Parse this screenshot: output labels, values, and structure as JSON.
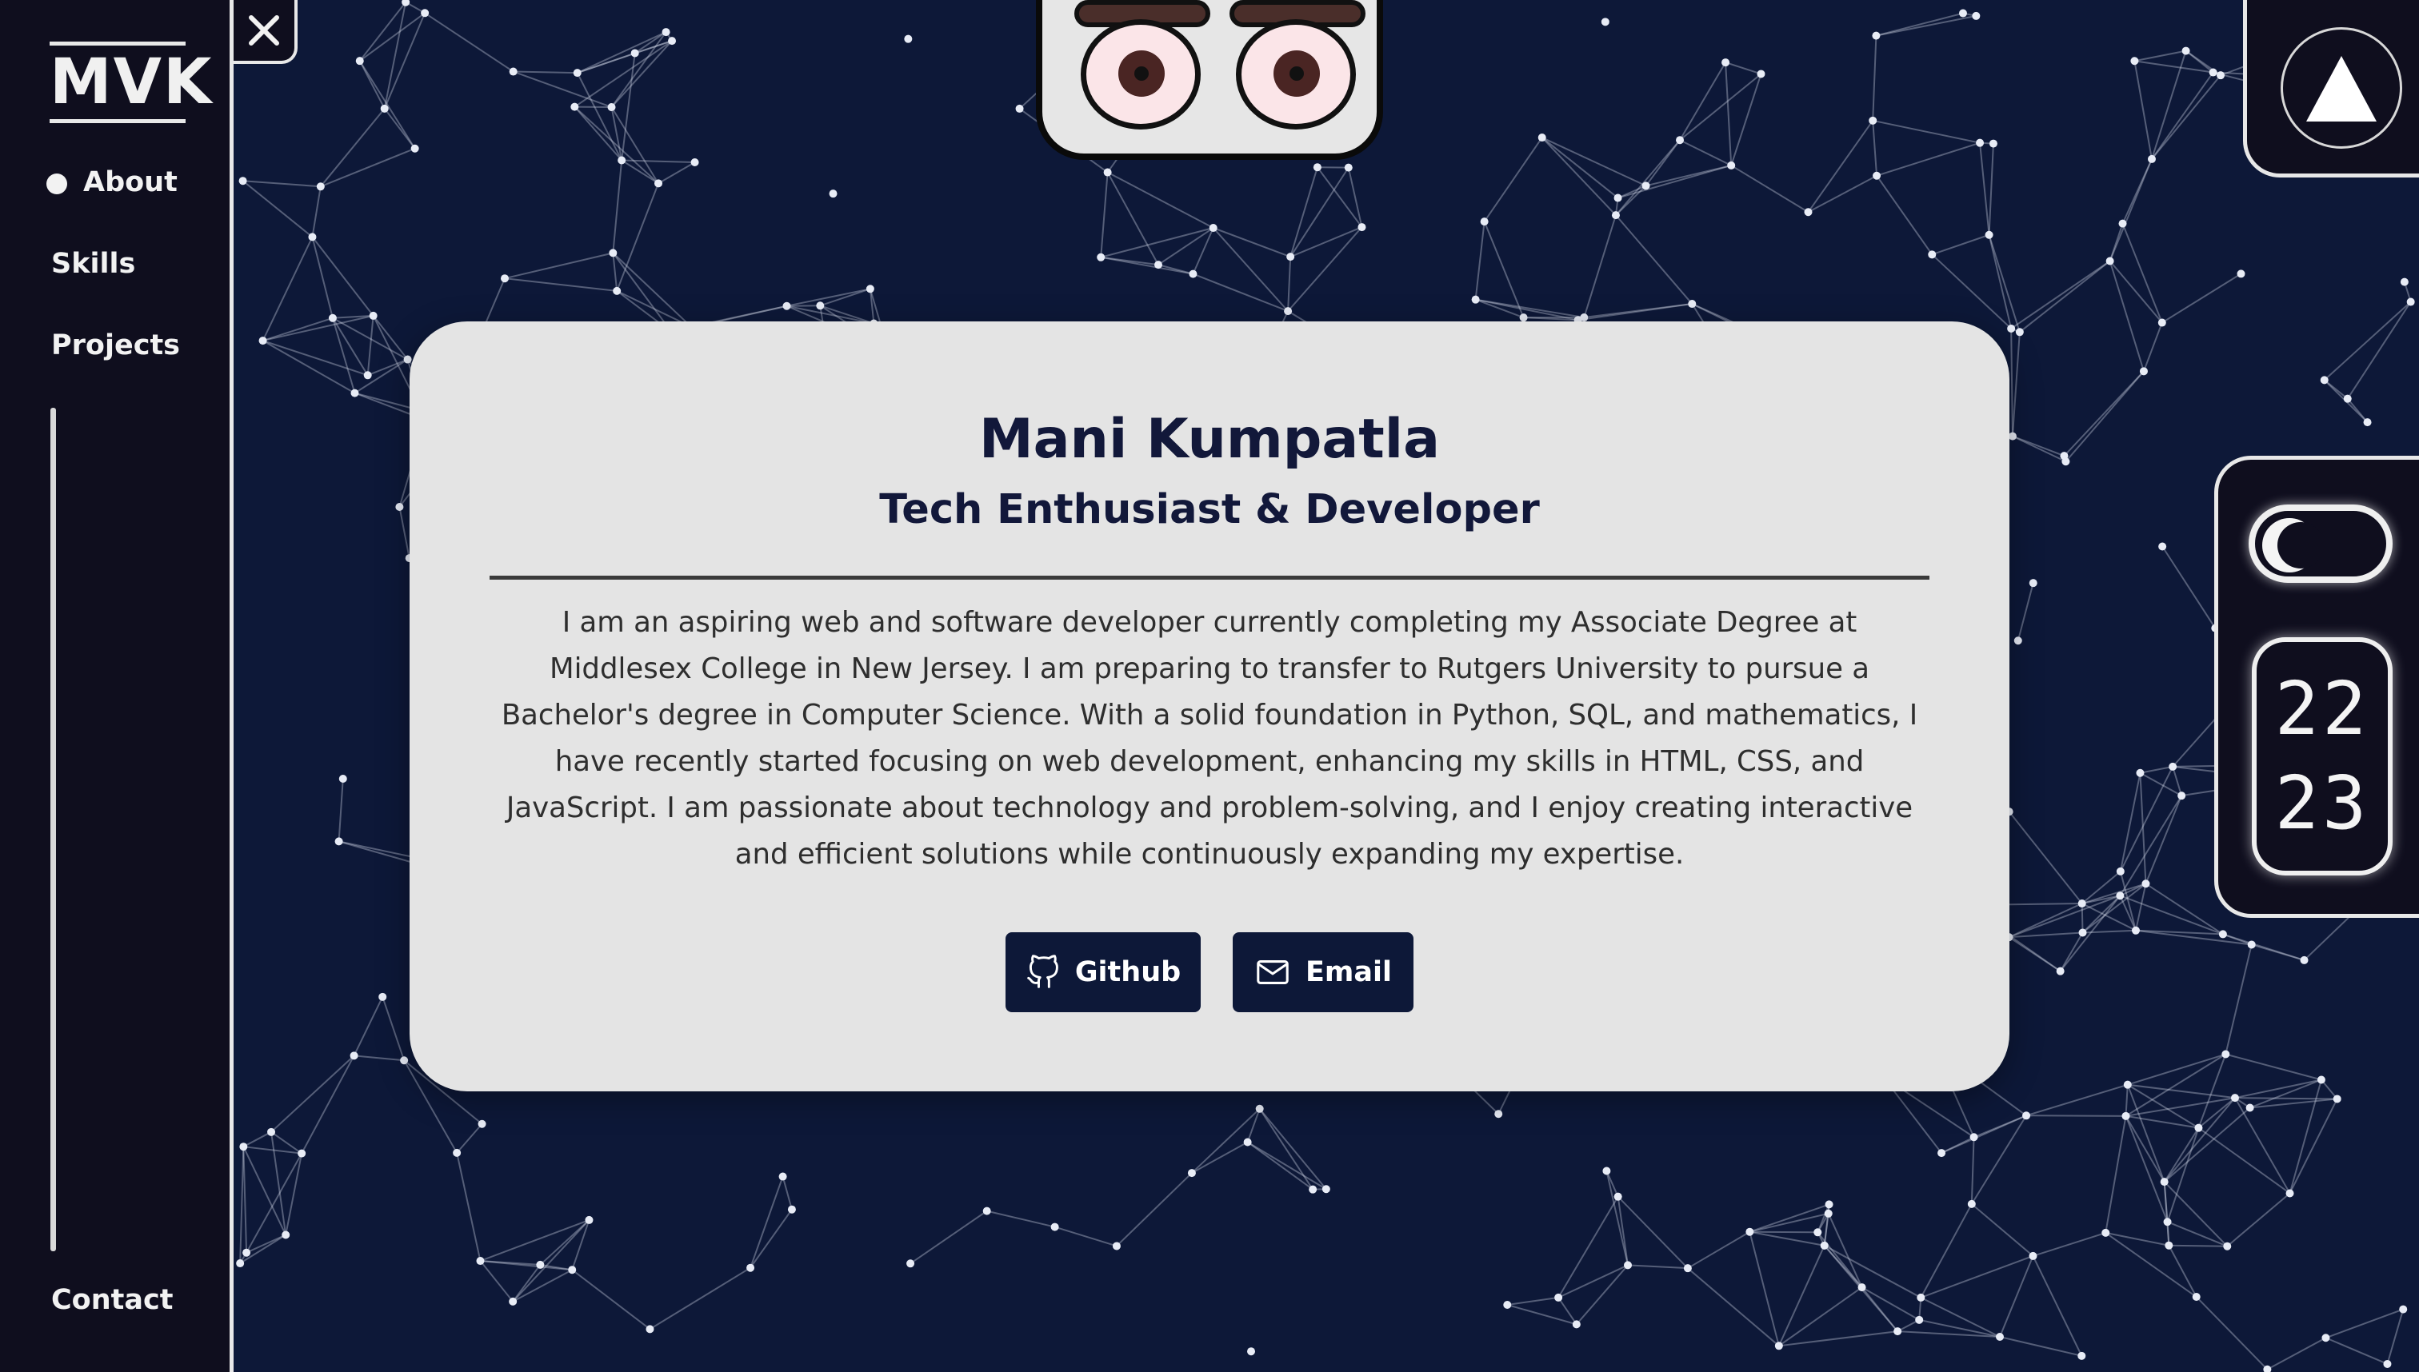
{
  "sidebar": {
    "logo": "MVK",
    "nav": [
      {
        "label": "About",
        "active": true
      },
      {
        "label": "Skills",
        "active": false
      },
      {
        "label": "Projects",
        "active": false
      }
    ],
    "contact_label": "Contact"
  },
  "profile": {
    "name": "Mani Kumpatla",
    "title": "Tech Enthusiast & Developer",
    "bio": "I am an aspiring web and software developer currently completing my Associate Degree at Middlesex College in New Jersey. I am preparing to transfer to Rutgers University to pursue a Bachelor's degree in Computer Science. With a solid foundation in Python, SQL, and mathematics, I have recently started focusing on web development, enhancing my skills in HTML, CSS, and JavaScript. I am passionate about technology and problem-solving, and I enjoy creating interactive and efficient solutions while continuously expanding my expertise.",
    "buttons": {
      "github_label": "Github",
      "email_label": "Email"
    }
  },
  "widgets": {
    "clock_hours": "22",
    "clock_minutes": "23",
    "theme": "dark"
  },
  "icons": {
    "close": "close-icon",
    "scroll_top": "triangle-up-icon",
    "github": "github-icon",
    "email": "mail-icon",
    "theme": "moon-icon"
  },
  "colors": {
    "background": "#0d1838",
    "sidebar": "#0f0e1e",
    "card": "#e4e4e4",
    "accent": "#12183a"
  }
}
